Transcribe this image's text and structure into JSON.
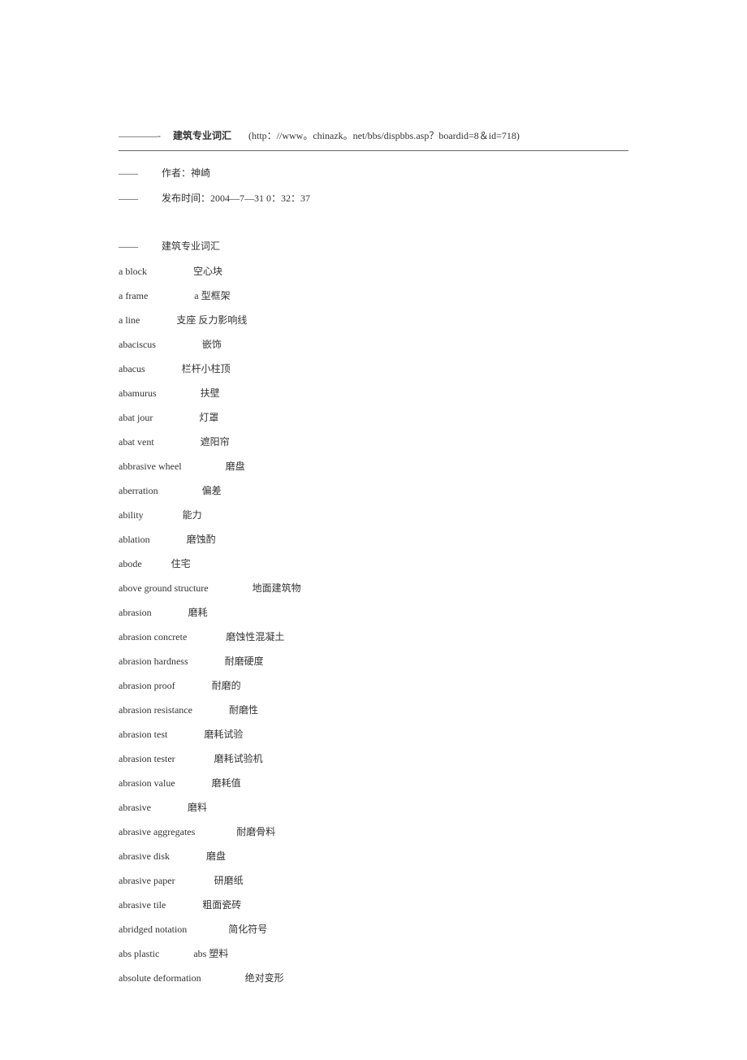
{
  "header": {
    "dashes": "————-",
    "title": "建筑专业词汇",
    "url": "(http：//www。chinazk。net/bbs/dispbbs.asp？boardid=8＆id=718)"
  },
  "meta": {
    "author_dash": "——",
    "author_label": "作者：神崎",
    "time_dash": "——",
    "time_label": "发布时间：2004—7—31 0：32：37"
  },
  "section": {
    "dash": "——",
    "label": "建筑专业词汇"
  },
  "terms": [
    "a block                   空心块",
    "a frame                   a 型框架",
    "a line               支座 反力影响线",
    "abaciscus                   嵌饰",
    "abacus               栏杆小柱顶",
    "abamurus                  扶壁",
    "abat jour                   灯罩",
    "abat vent                   遮阳帘",
    "abbrasive wheel                  磨盘",
    "aberration                  偏差",
    "ability                能力",
    "ablation               磨蚀酌",
    "abode            住宅",
    "above ground structure                  地面建筑物",
    "abrasion               磨耗",
    "abrasion concrete                磨蚀性混凝土",
    "abrasion hardness               耐磨硬度",
    "abrasion proof               耐磨的",
    "abrasion resistance               耐磨性",
    "abrasion test               磨耗试验",
    "abrasion tester                磨耗试验机",
    "abrasion value               磨耗值",
    "abrasive               磨料",
    "abrasive aggregates                 耐磨骨料",
    "abrasive disk               磨盘",
    "abrasive paper                研磨纸",
    "abrasive tile               粗面瓷砖",
    "abridged notation                 简化符号",
    "abs plastic              abs 塑料",
    "absolute deformation                  绝对变形"
  ]
}
